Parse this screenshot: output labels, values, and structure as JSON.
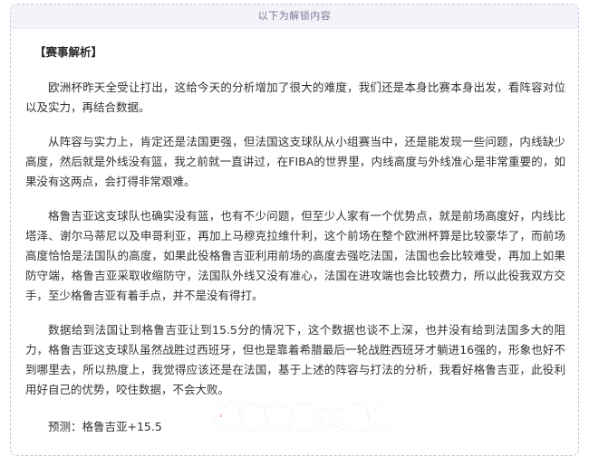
{
  "banner": {
    "text": "以下为解锁内容"
  },
  "article": {
    "section_title": "【赛事解析】",
    "paragraphs": [
      "欧洲杯昨天全受让打出，这给今天的分析增加了很大的难度，我们还是本身比赛本身出发，看阵容对位以及实力，再结合数据。",
      "从阵容与实力上，肯定还是法国更强，但法国这支球队从小组赛当中，还是能发现一些问题，内线缺少高度，然后就是外线没有篮，我之前就一直讲过，在FIBA的世界里，内线高度与外线准心是非常重要的，如果没有这两点，会打得非常艰难。",
      "格鲁吉亚这支球队也确实没有篮，也有不少问题，但至少人家有一个优势点，就是前场高度好，内线比塔泽、谢尔马蒂尼以及申哥利亚，再加上马穆克拉维什利，这个前场在整个欧洲杯算是比较豪华了，而前场高度恰恰是法国队的高度，如果此役格鲁吉亚利用前场的高度去强吃法国，法国也会比较难受，再加上如果防守端，格鲁吉亚采取收缩防守，法国队外线又没有准心，法国在进攻端也会比较费力，所以此役我双方交手，至少格鲁吉亚有着手点，并不是没有得打。",
      "数据给到法国让到格鲁吉亚让到15.5分的情况下，这个数据也谈不上深，也并没有给到法国多大的阻力，格鲁吉亚这支球队虽然战胜过西班牙，但也是靠着希腊最后一轮战胜西班牙才躺进16强的，形象也好不到哪里去，所以热度上，我觉得应该还是在法国，基于上述的阵容与打法的分析，我看好格鲁吉亚，此役利用好自己的优势，咬住数据，不会大败。"
    ],
    "prediction": "预测：格鲁吉亚+15.5",
    "headline": "格鲁吉亚大爆冷"
  },
  "colors": {
    "headline": "#ff1c0e",
    "banner_bg": "#f4f3f9",
    "border": "#c9c4dc",
    "body_text": "#333333"
  }
}
